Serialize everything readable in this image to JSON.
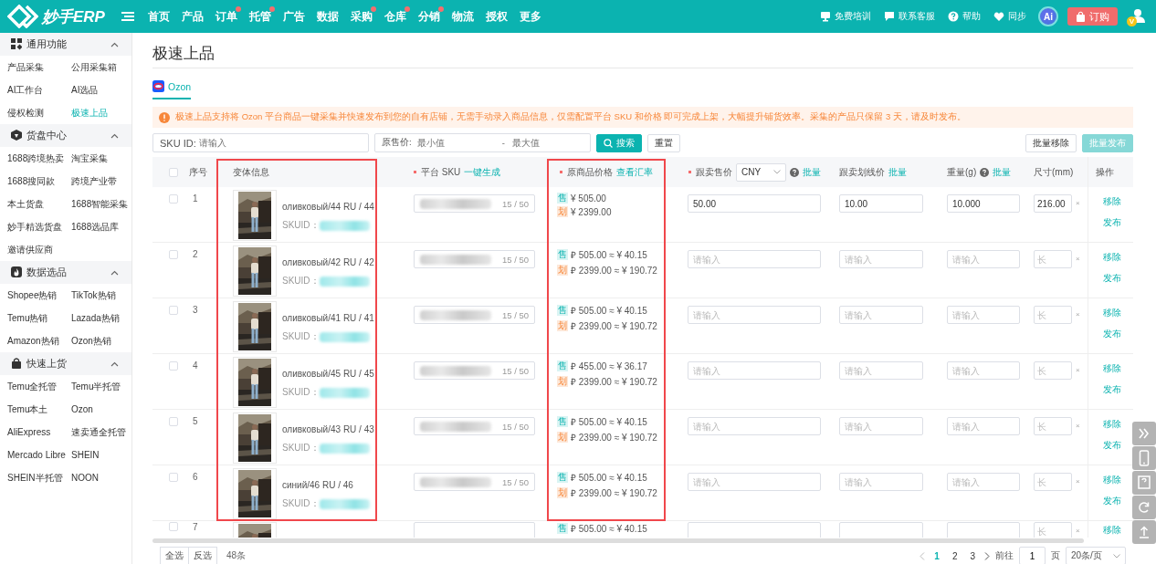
{
  "topbar": {
    "logo": "妙手ERP",
    "nav": [
      {
        "label": "首页",
        "dot": false
      },
      {
        "label": "产品",
        "dot": false
      },
      {
        "label": "订单",
        "dot": true
      },
      {
        "label": "托管",
        "dot": true
      },
      {
        "label": "广告",
        "dot": false
      },
      {
        "label": "数据",
        "dot": false
      },
      {
        "label": "采购",
        "dot": true
      },
      {
        "label": "仓库",
        "dot": true
      },
      {
        "label": "分销",
        "dot": true
      },
      {
        "label": "物流",
        "dot": false
      },
      {
        "label": "授权",
        "dot": false
      },
      {
        "label": "更多",
        "dot": false
      }
    ],
    "tools": [
      {
        "label": "免费培训",
        "kind": "monitor"
      },
      {
        "label": "联系客服",
        "kind": "chat"
      },
      {
        "label": "帮助",
        "kind": "help"
      },
      {
        "label": "同步",
        "kind": "sync"
      }
    ],
    "ai": "Ai",
    "subscribe": "订购",
    "user_badge": "V"
  },
  "sidebar": {
    "groups": [
      {
        "title": "通用功能",
        "kind": "grid",
        "expanded": true,
        "items": [
          {
            "label": "产品采集",
            "selected": false
          },
          {
            "label": "公用采集箱",
            "selected": false
          },
          {
            "label": "AI工作台",
            "selected": false
          },
          {
            "label": "AI选品",
            "selected": false
          },
          {
            "label": "侵权检测",
            "selected": false
          },
          {
            "label": "极速上品",
            "selected": true
          }
        ]
      },
      {
        "title": "货盘中心",
        "kind": "box",
        "expanded": true,
        "items": [
          {
            "label": "1688跨境热卖",
            "selected": false
          },
          {
            "label": "淘宝采集",
            "selected": false
          },
          {
            "label": "1688搜同款",
            "selected": false
          },
          {
            "label": "跨境产业带",
            "selected": false
          },
          {
            "label": "本土货盘",
            "selected": false
          },
          {
            "label": "1688智能采集",
            "selected": false
          },
          {
            "label": "妙手精选货盘",
            "selected": false
          },
          {
            "label": "1688选品库",
            "selected": false
          },
          {
            "label": "邀请供应商",
            "selected": false
          }
        ]
      },
      {
        "title": "数据选品",
        "kind": "fire",
        "expanded": true,
        "items": [
          {
            "label": "Shopee热销",
            "selected": false
          },
          {
            "label": "TikTok热销",
            "selected": false
          },
          {
            "label": "Temu热销",
            "selected": false
          },
          {
            "label": "Lazada热销",
            "selected": false
          },
          {
            "label": "Amazon热销",
            "selected": false
          },
          {
            "label": "Ozon热销",
            "selected": false
          }
        ]
      },
      {
        "title": "快速上货",
        "kind": "bag",
        "expanded": true,
        "items": [
          {
            "label": "Temu全托管",
            "selected": false
          },
          {
            "label": "Temu半托管",
            "selected": false
          },
          {
            "label": "Temu本土",
            "selected": false
          },
          {
            "label": "Ozon",
            "selected": false
          },
          {
            "label": "AliExpress",
            "selected": false
          },
          {
            "label": "速卖通全托管",
            "selected": false
          },
          {
            "label": "Mercado Libre",
            "selected": false
          },
          {
            "label": "SHEIN",
            "selected": false
          },
          {
            "label": "SHEIN半托管",
            "selected": false
          },
          {
            "label": "NOON",
            "selected": false
          }
        ]
      }
    ]
  },
  "page": {
    "title": "极速上品",
    "tabs": [
      {
        "label": "Ozon",
        "selected": true
      }
    ],
    "notice": "极速上品支持将 Ozon 平台商品一键采集并快速发布到您的自有店铺，无需手动录入商品信息，仅需配置平台 SKU 和价格 即可完成上架，大幅提升铺货效率。采集的产品只保留 3 天，请及时发布。",
    "filters": {
      "sku_label": "SKU ID:",
      "sku_placeholder": "请输入",
      "price_label": "原售价:",
      "min_placeholder": "最小值",
      "separator": "-",
      "max_placeholder": "最大值"
    },
    "buttons": [
      {
        "label": "搜索",
        "kind": "primary"
      },
      {
        "label": "重置",
        "kind": "default"
      }
    ],
    "bulk_buttons": [
      {
        "label": "批量移除",
        "kind": "default"
      },
      {
        "label": "批量发布",
        "kind": "disabled"
      }
    ]
  },
  "table": {
    "columns": [
      {
        "kind": "check",
        "checked": false
      },
      {
        "label": "序号",
        "kind": "text"
      },
      {
        "label": "变体信息",
        "kind": "text",
        "highlighted": true
      },
      {
        "label": "平台 SKU",
        "kind": "text",
        "required": true,
        "link": "一键生成"
      },
      {
        "label": "原商品价格",
        "kind": "text",
        "required": true,
        "link": "查看汇率",
        "highlighted": true
      },
      {
        "label": "跟卖售价",
        "kind": "text",
        "required": true,
        "select": "CNY",
        "help": true,
        "link": "批量"
      },
      {
        "label": "跟卖划线价",
        "kind": "text",
        "link": "批量"
      },
      {
        "label": "重量(g)",
        "kind": "text",
        "help": true,
        "link": "批量"
      },
      {
        "label": "尺寸(mm)",
        "kind": "text"
      },
      {
        "label": "操作",
        "kind": "text"
      }
    ],
    "rows": [
      {
        "checked": false,
        "partial": false,
        "index": "1",
        "variant": "оливковый/44 RU / 44",
        "skuid_label": "SKUID：",
        "sku_count": "15 / 50",
        "sale_tag": "售",
        "sale_price": "¥ 505.00",
        "list_tag": "划",
        "list_price": "¥ 2399.00",
        "follow_price": "50.00",
        "follow_list_price": "10.00",
        "weight": "10.000",
        "length": "216.00",
        "times": "×",
        "actions": [
          "移除",
          "发布"
        ]
      },
      {
        "checked": false,
        "partial": false,
        "index": "2",
        "variant": "оливковый/42 RU / 42",
        "skuid_label": "SKUID：",
        "sku_count": "15 / 50",
        "sale_tag": "售",
        "sale_price": "₽ 505.00 ≈ ¥ 40.15",
        "list_tag": "划",
        "list_price": "₽ 2399.00 ≈ ¥ 190.72",
        "follow_price_placeholder": "请输入",
        "follow_list_price_placeholder": "请输入",
        "weight_placeholder": "请输入",
        "length_placeholder": "长",
        "times": "×",
        "actions": [
          "移除",
          "发布"
        ]
      },
      {
        "checked": false,
        "partial": false,
        "index": "3",
        "variant": "оливковый/41 RU / 41",
        "skuid_label": "SKUID：",
        "sku_count": "15 / 50",
        "sale_tag": "售",
        "sale_price": "₽ 505.00 ≈ ¥ 40.15",
        "list_tag": "划",
        "list_price": "₽ 2399.00 ≈ ¥ 190.72",
        "follow_price_placeholder": "请输入",
        "follow_list_price_placeholder": "请输入",
        "weight_placeholder": "请输入",
        "length_placeholder": "长",
        "times": "×",
        "actions": [
          "移除",
          "发布"
        ]
      },
      {
        "checked": false,
        "partial": false,
        "index": "4",
        "variant": "оливковый/45 RU / 45",
        "skuid_label": "SKUID：",
        "sku_count": "15 / 50",
        "sale_tag": "售",
        "sale_price": "₽ 455.00 ≈ ¥ 36.17",
        "list_tag": "划",
        "list_price": "₽ 2399.00 ≈ ¥ 190.72",
        "follow_price_placeholder": "请输入",
        "follow_list_price_placeholder": "请输入",
        "weight_placeholder": "请输入",
        "length_placeholder": "长",
        "times": "×",
        "actions": [
          "移除",
          "发布"
        ]
      },
      {
        "checked": false,
        "partial": false,
        "index": "5",
        "variant": "оливковый/43 RU / 43",
        "skuid_label": "SKUID：",
        "sku_count": "15 / 50",
        "sale_tag": "售",
        "sale_price": "₽ 505.00 ≈ ¥ 40.15",
        "list_tag": "划",
        "list_price": "₽ 2399.00 ≈ ¥ 190.72",
        "follow_price_placeholder": "请输入",
        "follow_list_price_placeholder": "请输入",
        "weight_placeholder": "请输入",
        "length_placeholder": "长",
        "times": "×",
        "actions": [
          "移除",
          "发布"
        ]
      },
      {
        "checked": false,
        "partial": false,
        "index": "6",
        "variant": "синий/46 RU / 46",
        "skuid_label": "SKUID：",
        "sku_count": "15 / 50",
        "sale_tag": "售",
        "sale_price": "₽ 505.00 ≈ ¥ 40.15",
        "list_tag": "划",
        "list_price": "₽ 2399.00 ≈ ¥ 190.72",
        "follow_price_placeholder": "请输入",
        "follow_list_price_placeholder": "请输入",
        "weight_placeholder": "请输入",
        "length_placeholder": "长",
        "times": "×",
        "actions": [
          "移除",
          "发布"
        ]
      },
      {
        "checked": false,
        "partial": true,
        "index": "7",
        "sale_tag": "售",
        "sale_price": "₽ 505.00 ≈ ¥ 40.15",
        "length_placeholder": "长",
        "times": "×",
        "actions": [
          "移除"
        ]
      }
    ]
  },
  "footer": {
    "select_all": "全选",
    "invert": "反选",
    "total": "48条",
    "pages": [
      {
        "label": "1",
        "selected": true
      },
      {
        "label": "2",
        "selected": false
      },
      {
        "label": "3",
        "selected": false
      }
    ],
    "goto": "前往",
    "page_input": "1",
    "page_unit": "页",
    "page_size": "20条/页"
  },
  "side_buttons": [
    {
      "kind": "expand"
    },
    {
      "kind": "phone"
    },
    {
      "kind": "help"
    },
    {
      "kind": "refresh"
    },
    {
      "kind": "top"
    }
  ]
}
